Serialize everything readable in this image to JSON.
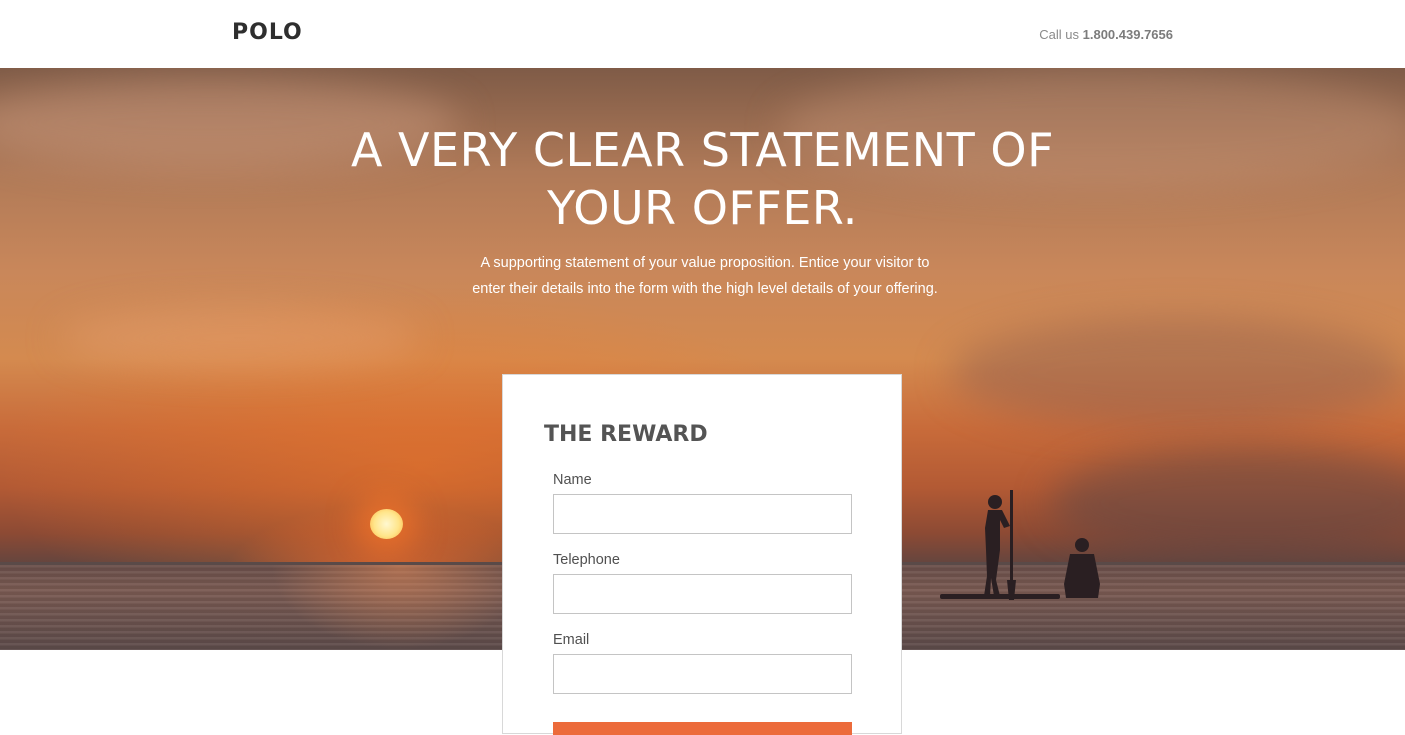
{
  "header": {
    "logo": "POLO",
    "call_prefix": "Call us",
    "phone": "1.800.439.7656"
  },
  "hero": {
    "headline_line1": "A VERY CLEAR STATEMENT OF",
    "headline_line2": "YOUR OFFER.",
    "subhead": "A supporting statement of your value proposition. Entice your visitor to enter their details into the form with the high level details of your offering."
  },
  "form": {
    "title": "THE REWARD",
    "fields": [
      {
        "label": "Name",
        "value": ""
      },
      {
        "label": "Telephone",
        "value": ""
      },
      {
        "label": "Email",
        "value": ""
      }
    ],
    "submit_color": "#ec6b3b"
  },
  "colors": {
    "accent": "#ec6b3b",
    "text_dark": "#2e2e2e"
  }
}
